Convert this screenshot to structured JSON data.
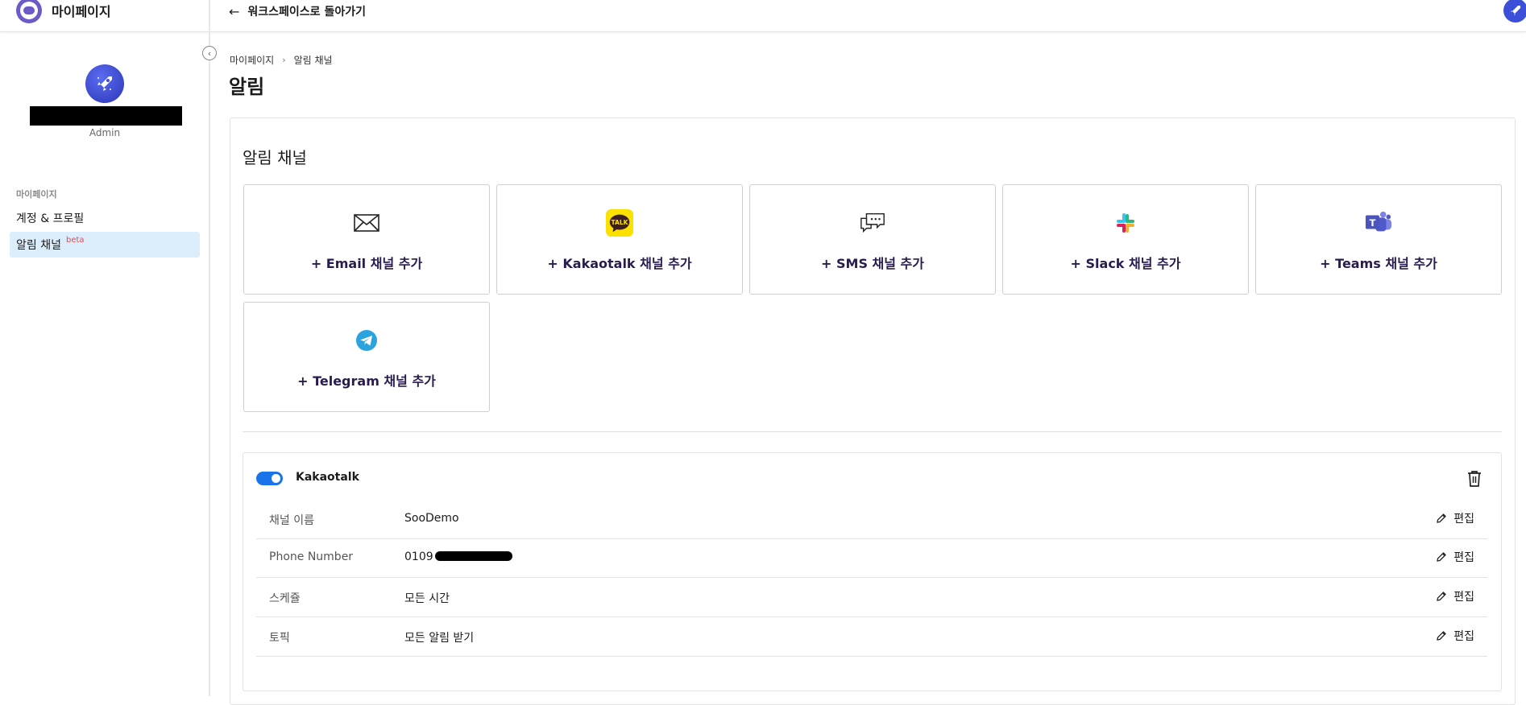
{
  "header": {
    "app_title": "마이페이지",
    "back_label": "워크스페이스로 돌아가기"
  },
  "sidebar": {
    "user_role": "Admin",
    "section_label": "마이페이지",
    "items": [
      {
        "label": "계정 & 프로필",
        "active": false
      },
      {
        "label": "알림 채널",
        "badge": "beta",
        "active": true
      }
    ]
  },
  "breadcrumb": [
    "마이페이지",
    "알림 채널"
  ],
  "page": {
    "title": "알림",
    "section_title": "알림 채널"
  },
  "add_channels": [
    {
      "label": "+ Email 채널 추가",
      "icon": "envelope-icon"
    },
    {
      "label": "+ Kakaotalk 채널 추가",
      "icon": "kakaotalk-icon"
    },
    {
      "label": "+ SMS 채널 추가",
      "icon": "sms-chat-icon"
    },
    {
      "label": "+ Slack 채널 추가",
      "icon": "slack-icon"
    },
    {
      "label": "+ Teams 채널 추가",
      "icon": "teams-icon"
    },
    {
      "label": "+ Telegram 채널 추가",
      "icon": "telegram-icon"
    }
  ],
  "channel": {
    "name": "Kakaotalk",
    "enabled": true,
    "toggle_color": "#1a73e8",
    "edit_label": "편집",
    "rows": [
      {
        "key": "채널 이름",
        "value": "SooDemo"
      },
      {
        "key": "Phone Number",
        "value": "0109"
      },
      {
        "key": "스케쥴",
        "value": "모든 시간"
      },
      {
        "key": "토픽",
        "value": "모든 알림 받기"
      }
    ]
  },
  "colors": {
    "accent": "#1a73e8",
    "active_nav_bg": "#dceefb",
    "card_label": "#2a1b4f",
    "beta_badge": "#e5484d"
  }
}
